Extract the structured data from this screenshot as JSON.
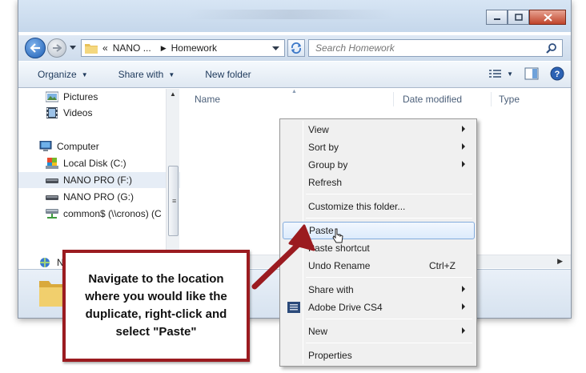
{
  "address": {
    "crumbs": [
      "NANO ...",
      "Homework"
    ],
    "prefix": "«"
  },
  "search": {
    "placeholder": "Search Homework"
  },
  "toolbar": {
    "organize": "Organize",
    "share_with": "Share with",
    "new_folder": "New folder"
  },
  "nav": {
    "items": [
      {
        "label": "Pictures",
        "icon": "pictures-icon"
      },
      {
        "label": "Videos",
        "icon": "videos-icon"
      },
      {
        "label": "Computer",
        "icon": "computer-icon"
      },
      {
        "label": "Local Disk (C:)",
        "icon": "local-disk-icon"
      },
      {
        "label": "NANO PRO (F:)",
        "icon": "usb-drive-icon"
      },
      {
        "label": "NANO PRO (G:)",
        "icon": "usb-drive-icon"
      },
      {
        "label": "common$ (\\\\cronos) (C",
        "icon": "network-drive-icon"
      },
      {
        "label": "N",
        "icon": "network-icon"
      }
    ]
  },
  "columns": {
    "name": "Name",
    "date_modified": "Date modified",
    "type": "Type"
  },
  "context_menu": {
    "items": [
      {
        "label": "View",
        "submenu": true
      },
      {
        "label": "Sort by",
        "submenu": true
      },
      {
        "label": "Group by",
        "submenu": true
      },
      {
        "label": "Refresh"
      },
      {
        "label": "Customize this folder..."
      },
      {
        "label": "Paste",
        "highlighted": true
      },
      {
        "label": "Paste shortcut"
      },
      {
        "label": "Undo Rename",
        "shortcut": "Ctrl+Z"
      },
      {
        "label": "Share with",
        "submenu": true
      },
      {
        "label": "Adobe Drive CS4",
        "submenu": true,
        "icon": "adobe-drive-icon"
      },
      {
        "label": "New",
        "submenu": true
      },
      {
        "label": "Properties"
      }
    ]
  },
  "callout": {
    "text": "Navigate to the location where you would like the duplicate, right-click and select \"Paste\""
  },
  "colors": {
    "callout_border": "#9b1b20",
    "arrow": "#9b1b20",
    "menu_highlight": "#dcebfc"
  }
}
